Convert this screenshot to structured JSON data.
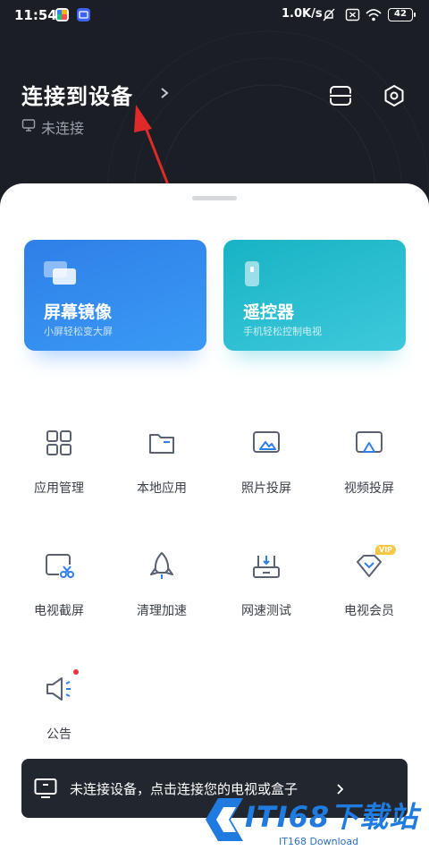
{
  "status_bar": {
    "time": "11:54",
    "net_speed": "1.0K/s",
    "battery": "42"
  },
  "header": {
    "title": "连接到设备",
    "connection_status": "未连接"
  },
  "cards": [
    {
      "title": "屏幕镜像",
      "subtitle": "小屏轻松变大屏"
    },
    {
      "title": "遥控器",
      "subtitle": "手机轻松控制电视"
    }
  ],
  "grid": [
    {
      "label": "应用管理",
      "icon": "apps-grid-icon"
    },
    {
      "label": "本地应用",
      "icon": "folder-icon"
    },
    {
      "label": "照片投屏",
      "icon": "photo-cast-icon"
    },
    {
      "label": "视频投屏",
      "icon": "video-cast-icon"
    },
    {
      "label": "电视截屏",
      "icon": "tv-screenshot-icon"
    },
    {
      "label": "清理加速",
      "icon": "rocket-icon"
    },
    {
      "label": "网速测试",
      "icon": "router-icon"
    },
    {
      "label": "电视会员",
      "icon": "vip-diamond-icon"
    },
    {
      "label": "公告",
      "icon": "megaphone-icon"
    }
  ],
  "vip_badge": "VIP",
  "notice": {
    "text": "未连接设备，点击连接您的电视或盒子"
  },
  "watermark": {
    "title": "ITI68下载站",
    "subtitle": "IT168 Download"
  },
  "colors": {
    "header_bg": "#1b1e25",
    "mirror_card": "#3a9af5",
    "remote_card": "#2ec0d3",
    "icon_stroke": "#5a6170",
    "accent_blue": "#2f7fe8",
    "badge_red": "#e8343a"
  }
}
